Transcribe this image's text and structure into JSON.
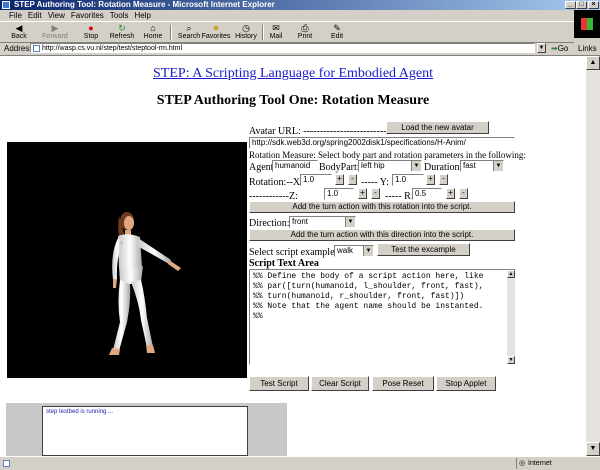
{
  "window": {
    "title": "STEP Authoring Tool: Rotation Measure - Microsoft Internet Explorer",
    "controls": {
      "minimize": "_",
      "maximize": "□",
      "close": "×"
    }
  },
  "menu": [
    "File",
    "Edit",
    "View",
    "Favorites",
    "Tools",
    "Help"
  ],
  "toolbar": {
    "back": "Back",
    "forward": "Forward",
    "stop": "Stop",
    "refresh": "Refresh",
    "home": "Home",
    "search": "Search",
    "favorites": "Favorites",
    "history": "History",
    "mail": "Mail",
    "print": "Print",
    "edit": "Edit"
  },
  "address": {
    "label": "Address",
    "url": "http://wasp.cs.vu.nl/step/test/steptool-rm.html",
    "go": "Go",
    "links": "Links"
  },
  "page": {
    "heading_link": "STEP: A Scripting Language for Embodied Agent",
    "subtitle": "STEP Authoring Tool One: Rotation Measure"
  },
  "applet": {
    "avatar_url_label": "Avatar URL: ----------------------------",
    "load_avatar_button": "Load the new avatar",
    "avatar_url_value": "http://sdk.web3d.org/spring2002disk1/specifications/H-Anim/",
    "rotation_instructions": "Rotation Measure:  Select body part and rotation parameters in the following:",
    "agent_label": "Agent:",
    "agent_value": "humanoid",
    "bodypart_label": "BodyPart:",
    "bodypart_value": "left hip",
    "duration_label": "Duration:",
    "duration_value": "fast",
    "rotation_x_label": "Rotation:--X:",
    "rotation_x_value": "1.0",
    "rotation_y_label": "----- Y:",
    "rotation_y_value": "1.0",
    "rotation_z_label": "------------Z:",
    "rotation_z_value": "1.0",
    "rotation_r_label": "----- R:",
    "rotation_r_value": "0.5",
    "plus": "+",
    "minus": "-",
    "add_turn_rotation_button": "Add the turn action with this rotation into the script.",
    "direction_label": "Direction:",
    "direction_value": "front",
    "add_turn_direction_button": "Add the turn action with this direction into the script.",
    "script_example_label": "Select script example:",
    "script_example_value": "walk",
    "test_example_button": "Test the excample",
    "script_area_label": "Script Text Area",
    "script_lines": [
      "%% Define the body of a script action here, like",
      "%% par([turn(humanoid, l_shoulder, front, fast),",
      "%% turn(humanoid, r_shoulder, front, fast)])",
      "%% Note that the agent name should be instanted.",
      "%%"
    ],
    "test_script_button": "Test Script",
    "clear_script_button": "Clear Script",
    "pose_reset_button": "Pose Reset",
    "stop_applet_button": "Stop Applet"
  },
  "console": {
    "message": "step testbed is running ..."
  },
  "status": {
    "zone": "Internet"
  }
}
